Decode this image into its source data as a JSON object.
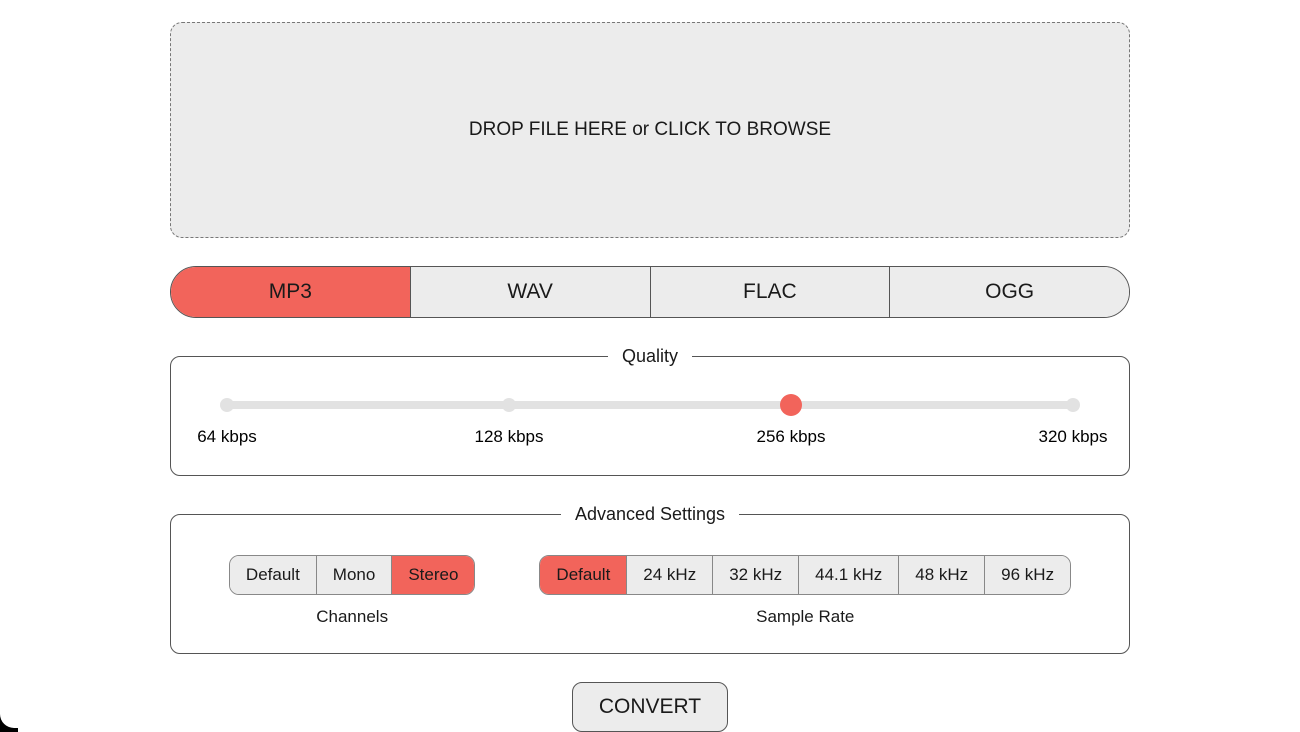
{
  "dropzone": {
    "text": "DROP FILE HERE or CLICK TO BROWSE"
  },
  "formats": {
    "options": [
      "MP3",
      "WAV",
      "FLAC",
      "OGG"
    ],
    "selected_index": 0
  },
  "quality": {
    "legend": "Quality",
    "stops": [
      "64 kbps",
      "128 kbps",
      "256 kbps",
      "320 kbps"
    ],
    "selected_index": 2
  },
  "advanced": {
    "legend": "Advanced Settings",
    "channels": {
      "label": "Channels",
      "options": [
        "Default",
        "Mono",
        "Stereo"
      ],
      "selected_index": 2
    },
    "sample_rate": {
      "label": "Sample Rate",
      "options": [
        "Default",
        "24 kHz",
        "32 kHz",
        "44.1 kHz",
        "48 kHz",
        "96 kHz"
      ],
      "selected_index": 0
    }
  },
  "convert": {
    "label": "CONVERT"
  },
  "accent_color": "#f2645b"
}
